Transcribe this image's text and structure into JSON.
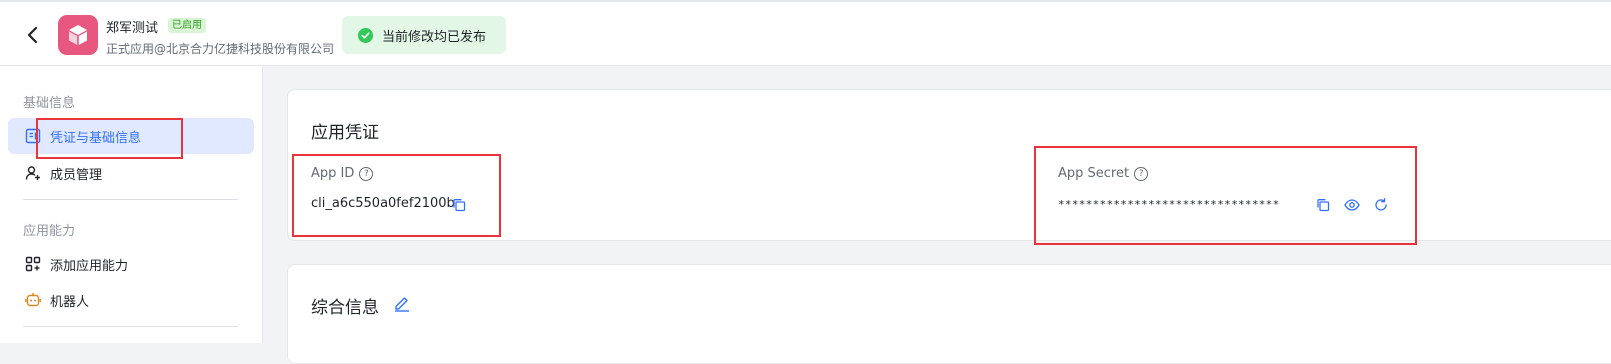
{
  "header": {
    "app_name": "郑军测试",
    "status_badge": "已启用",
    "app_subtitle": "正式应用@北京合力亿捷科技股份有限公司",
    "toast_text": "当前修改均已发布"
  },
  "sidebar": {
    "group_basic": "基础信息",
    "group_ability": "应用能力",
    "items": [
      {
        "label": "凭证与基础信息",
        "icon": "credential-icon"
      },
      {
        "label": "成员管理",
        "icon": "add-member-icon"
      },
      {
        "label": "添加应用能力",
        "icon": "grid-icon"
      },
      {
        "label": "机器人",
        "icon": "robot-icon"
      }
    ]
  },
  "credentials": {
    "title": "应用凭证",
    "app_id_label": "App ID",
    "app_id_value": "cli_a6c550a0fef2100b",
    "app_secret_label": "App Secret",
    "app_secret_value": "********************************"
  },
  "general": {
    "title": "综合信息"
  },
  "colors": {
    "accent": "#3370ff",
    "highlight_box": "#e8343a",
    "toast_bg": "#e3f7e6",
    "logo_bg": "#e8577f"
  }
}
